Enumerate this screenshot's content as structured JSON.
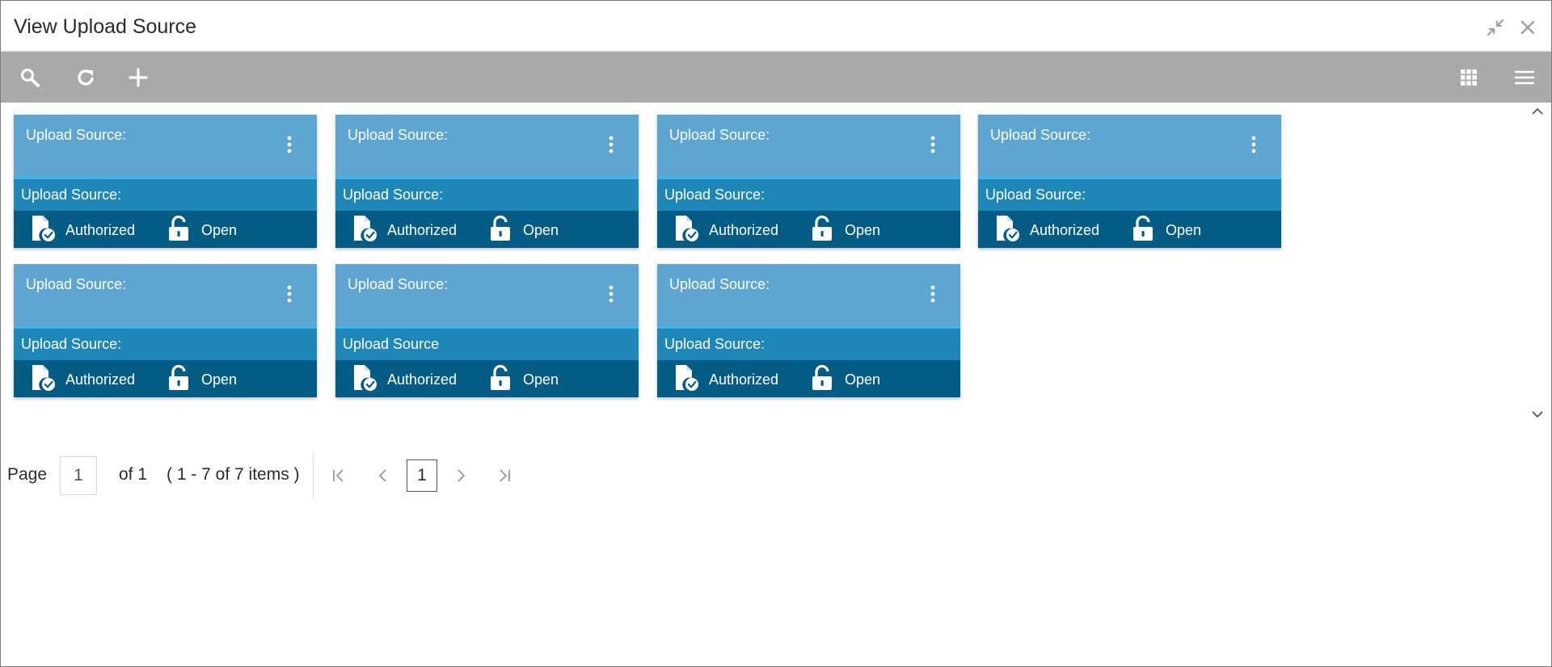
{
  "window": {
    "title": "View Upload Source"
  },
  "toolbar": {
    "left_icons": [
      "search-icon",
      "refresh-icon",
      "add-icon"
    ],
    "right_icons": [
      "grid-view-icon",
      "list-menu-icon"
    ],
    "toolbar_color": "#a9a9a9"
  },
  "cards": [
    {
      "top_label": "Upload Source:",
      "mid_label": "Upload Source:",
      "auth_status": "Authorized",
      "record_status": "Open"
    },
    {
      "top_label": "Upload Source:",
      "mid_label": "Upload Source:",
      "auth_status": "Authorized",
      "record_status": "Open"
    },
    {
      "top_label": "Upload Source:",
      "mid_label": "Upload Source:",
      "auth_status": "Authorized",
      "record_status": "Open"
    },
    {
      "top_label": "Upload Source:",
      "mid_label": "Upload Source:",
      "auth_status": "Authorized",
      "record_status": "Open"
    },
    {
      "top_label": "Upload Source:",
      "mid_label": "Upload Source:",
      "auth_status": "Authorized",
      "record_status": "Open"
    },
    {
      "top_label": "Upload Source:",
      "mid_label": "Upload Source",
      "auth_status": "Authorized",
      "record_status": "Open"
    },
    {
      "top_label": "Upload Source:",
      "mid_label": "Upload Source:",
      "auth_status": "Authorized",
      "record_status": "Open"
    }
  ],
  "card_colors": {
    "top": "#5ea5d2",
    "accent": "#39b6ee",
    "middle": "#1f87b8",
    "bottom": "#045b84"
  },
  "pagination": {
    "page_label": "Page",
    "page_value": "1",
    "of_label": "of 1",
    "items_summary": "( 1 - 7 of 7 items )",
    "current_page": "1"
  }
}
